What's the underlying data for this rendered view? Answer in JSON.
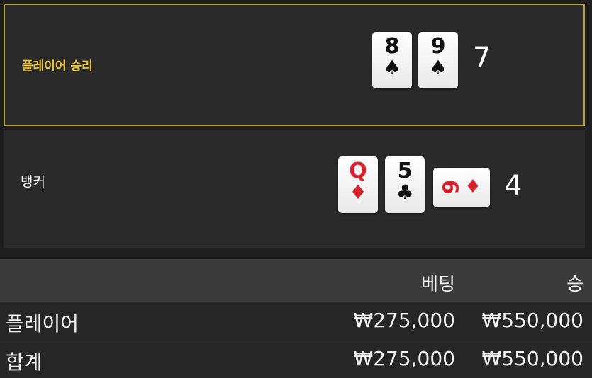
{
  "player": {
    "label": "플레이어 승리",
    "cards": [
      {
        "rank": "8",
        "suit": "♠",
        "color": "#111111"
      },
      {
        "rank": "9",
        "suit": "♠",
        "color": "#111111"
      }
    ],
    "score": "7"
  },
  "banker": {
    "label": "뱅커",
    "cards": [
      {
        "rank": "Q",
        "suit": "♦",
        "color": "#d7202b"
      },
      {
        "rank": "5",
        "suit": "♣",
        "color": "#111111"
      },
      {
        "rank": "6",
        "suit": "♦",
        "color": "#d7202b",
        "orientation": "horizontal"
      }
    ],
    "score": "4"
  },
  "table": {
    "headers": {
      "bet": "베팅",
      "win": "승"
    },
    "rows": [
      {
        "label": "플레이어",
        "bet": "₩275,000",
        "win": "₩550,000"
      },
      {
        "label": "합계",
        "bet": "₩275,000",
        "win": "₩550,000"
      }
    ]
  },
  "colors": {
    "highlight": "#b5a13a",
    "winner_text": "#e8c23a",
    "red_suit": "#d7202b"
  }
}
